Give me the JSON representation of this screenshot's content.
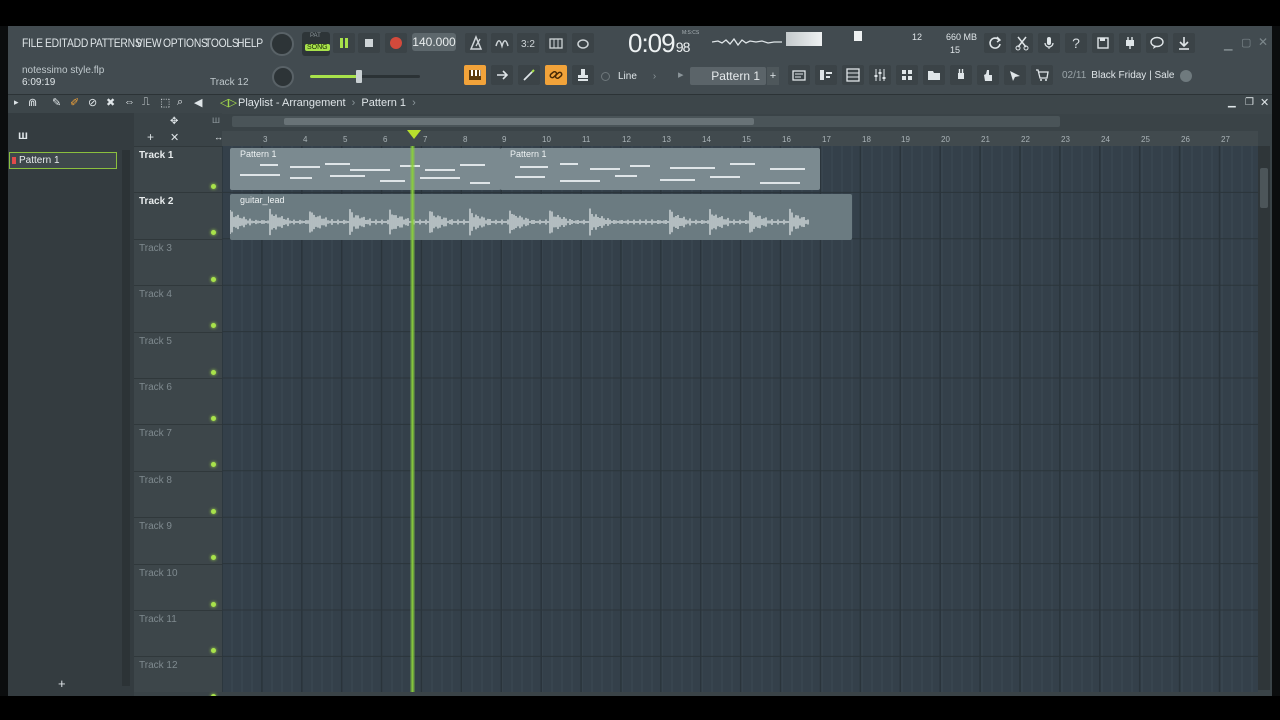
{
  "menu": [
    "FILE",
    "EDIT",
    "ADD",
    "PATTERNS",
    "VIEW",
    "OPTIONS",
    "TOOLS",
    "HELP"
  ],
  "transport": {
    "mode_pat": "PAT",
    "mode_song": "SONG",
    "tempo": "140.000",
    "time_main": "0:09",
    "time_sub": "98",
    "time_unit": "M:S:CS"
  },
  "project": {
    "file_name": "notessimo style.flp",
    "elapsed": "6:09:19",
    "hint_track": "Track 12"
  },
  "monitor": {
    "cpu": "12",
    "memory": "660 MB",
    "polyphony": "15"
  },
  "snap": {
    "value": "Line"
  },
  "pattern_selector": {
    "value": "Pattern 1"
  },
  "news": {
    "counter": "02/11",
    "text": "Black Friday | Sale"
  },
  "playlist": {
    "title": "Playlist - Arrangement",
    "pattern": "Pattern 1",
    "picker_items": [
      "Pattern 1"
    ],
    "ruler": [
      "3",
      "4",
      "5",
      "6",
      "7",
      "8",
      "9",
      "10",
      "11",
      "12",
      "13",
      "14",
      "15",
      "16",
      "17",
      "18",
      "19",
      "20",
      "21",
      "22",
      "23",
      "24",
      "25",
      "26",
      "27"
    ],
    "tracks": [
      "Track 1",
      "Track 2",
      "Track 3",
      "Track 4",
      "Track 5",
      "Track 6",
      "Track 7",
      "Track 8",
      "Track 9",
      "Track 10",
      "Track 11",
      "Track 12"
    ],
    "clips": {
      "p1a": "Pattern 1",
      "p1b": "Pattern 1",
      "audio": "guitar_lead"
    }
  },
  "colors": {
    "accent_green": "#8bd03b",
    "record_red": "#d24a3c",
    "selected_orange": "#f2a33a"
  }
}
